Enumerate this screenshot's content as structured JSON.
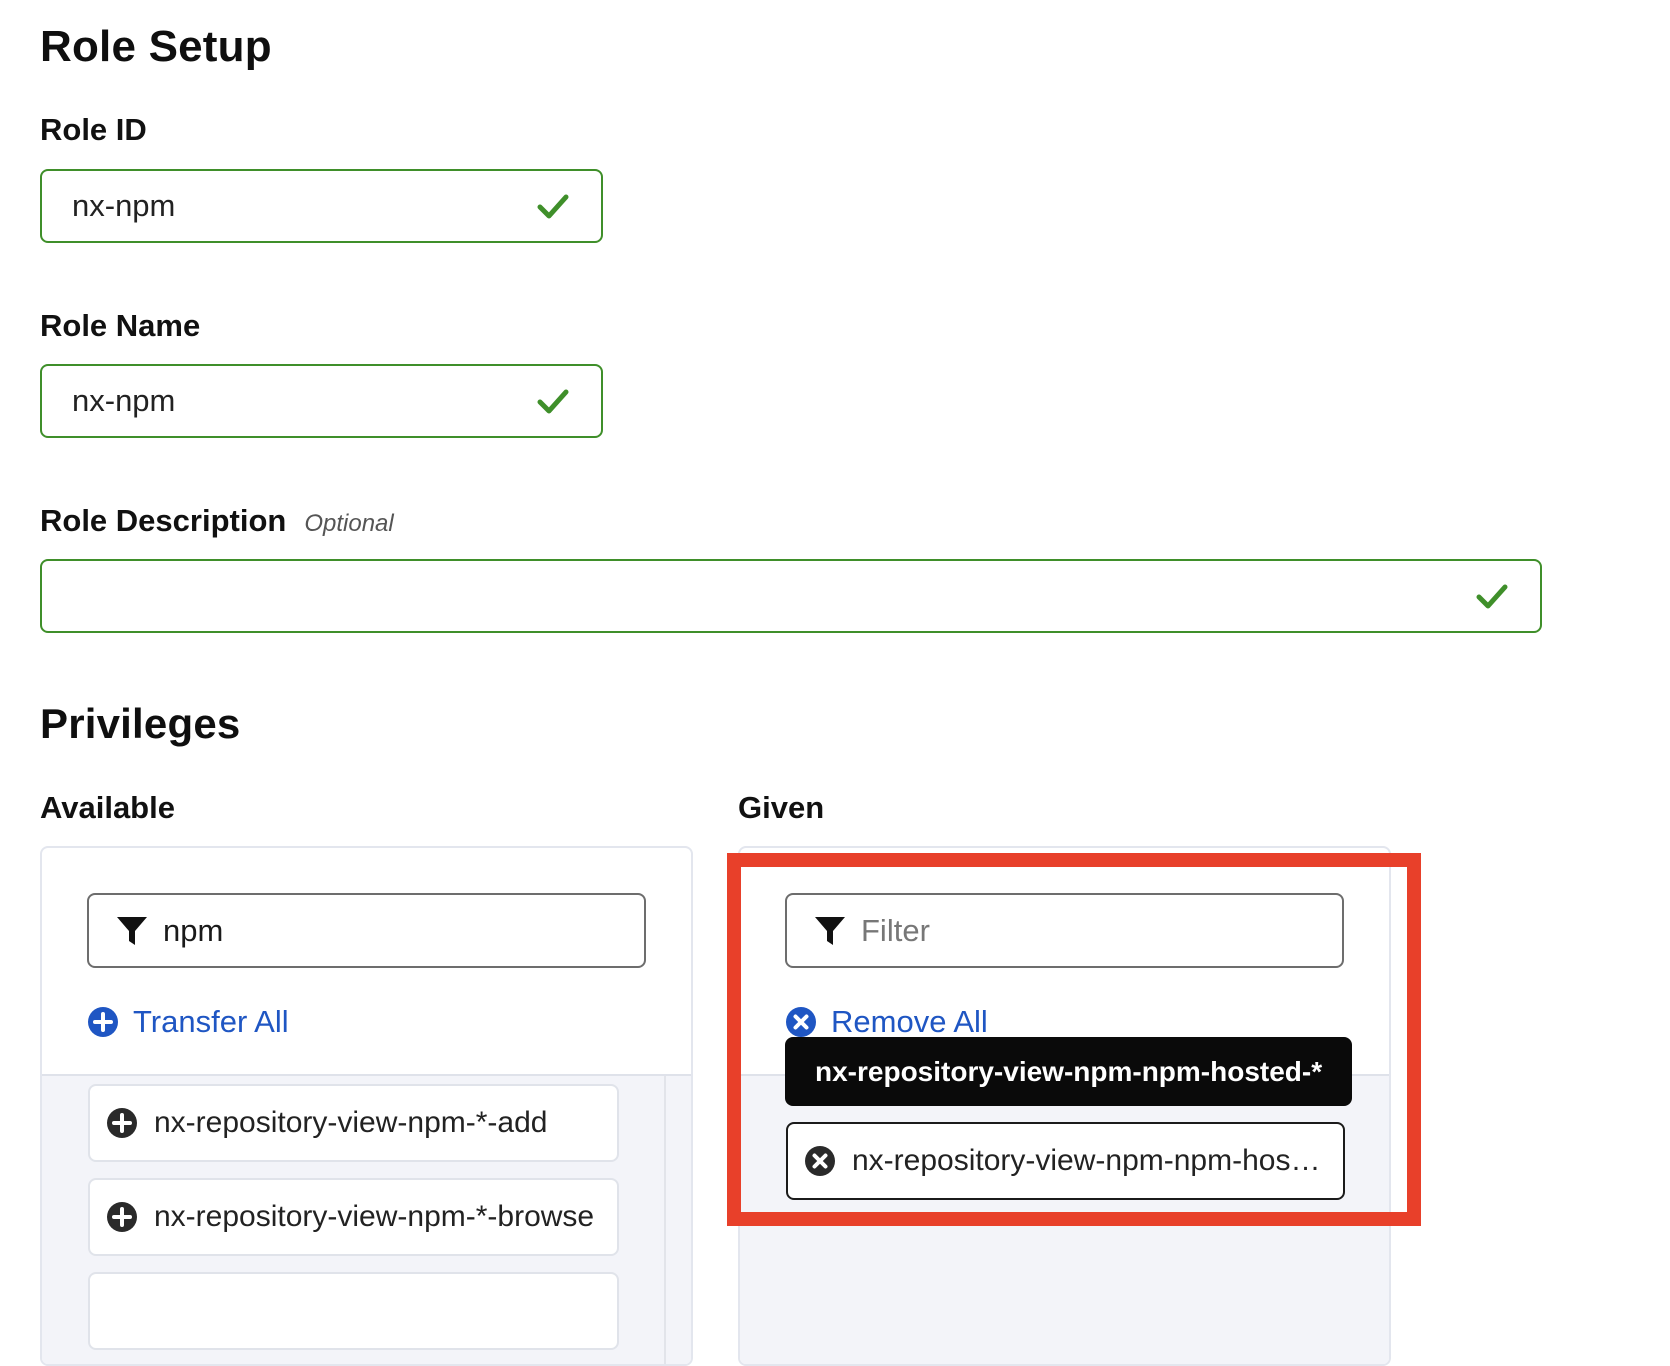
{
  "headings": {
    "role_setup": "Role Setup",
    "privileges": "Privileges"
  },
  "role_id": {
    "label": "Role ID",
    "value": "nx-npm"
  },
  "role_name": {
    "label": "Role Name",
    "value": "nx-npm"
  },
  "role_description": {
    "label": "Role Description",
    "optional": "Optional",
    "value": ""
  },
  "available": {
    "label": "Available",
    "filter_value": "npm",
    "transfer_all": "Transfer All",
    "items": [
      "nx-repository-view-npm-*-add",
      "nx-repository-view-npm-*-browse"
    ]
  },
  "given": {
    "label": "Given",
    "filter_placeholder": "Filter",
    "remove_all": "Remove All",
    "tooltip": "nx-repository-view-npm-npm-hosted-*",
    "items": [
      "nx-repository-view-npm-npm-hoste..."
    ]
  },
  "colors": {
    "valid_green": "#3f8f2a",
    "link_blue": "#1f56c3",
    "highlight_red": "#e8402a",
    "tooltip_bg": "#0a0a0a"
  },
  "icons": {
    "valid": "check-icon",
    "filter": "funnel-icon",
    "add": "plus-circle-icon",
    "remove": "x-circle-icon"
  }
}
